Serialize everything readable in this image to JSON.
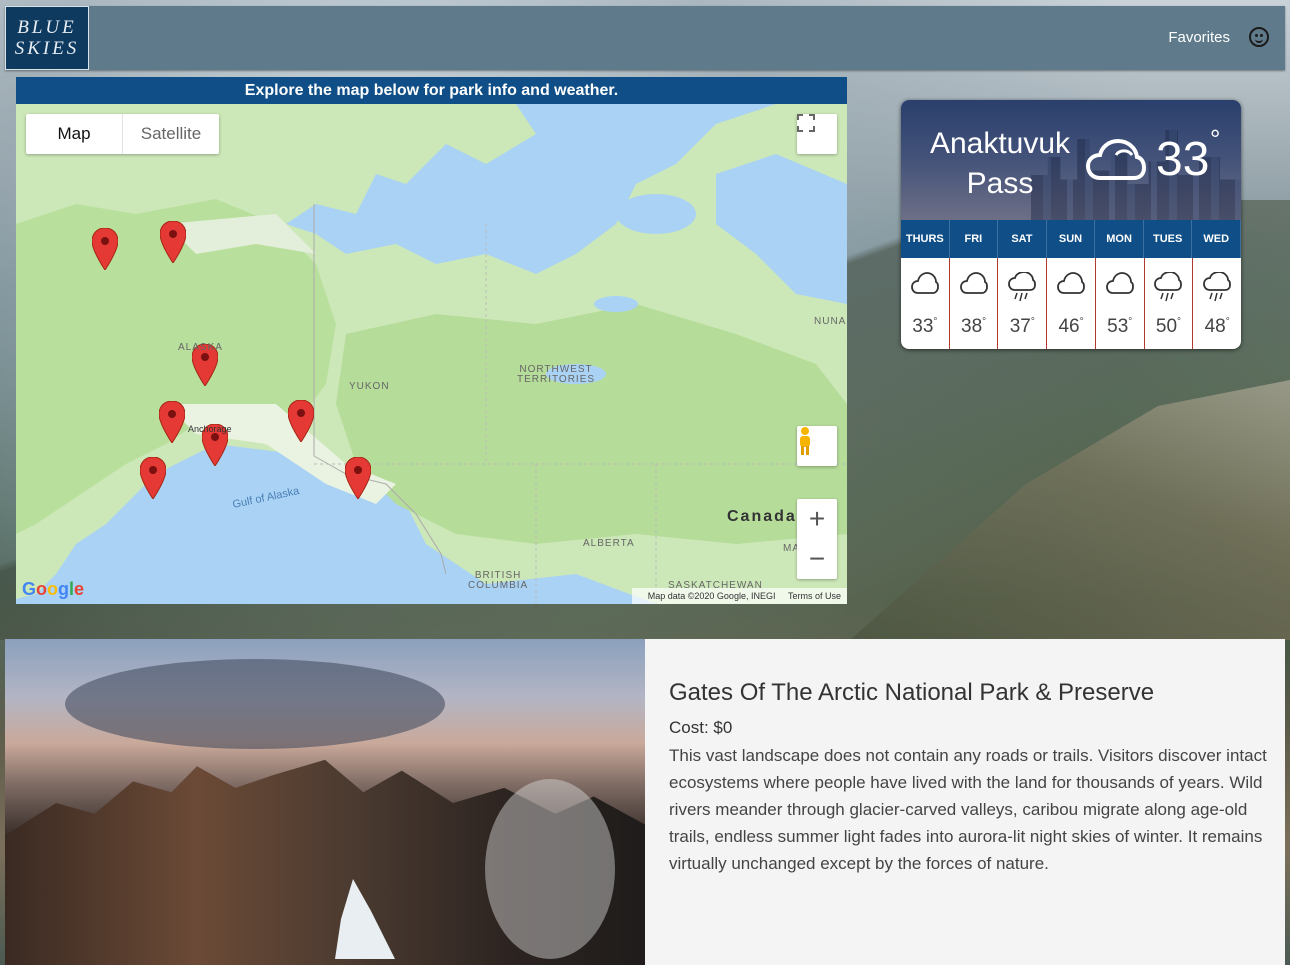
{
  "header": {
    "logo_line1": "BLUE",
    "logo_line2": "SKIES",
    "favorites_label": "Favorites",
    "favorites_icon": "smiley-icon"
  },
  "map_panel": {
    "banner": "Explore the map below for park info and weather.",
    "map_type_options": [
      "Map",
      "Satellite"
    ],
    "selected_map_type": "Map",
    "labels": {
      "yukon": "YUKON",
      "northwest": "NORTHWEST",
      "territories": "TERRITORIES",
      "alaska": "ALASKA",
      "anchorage": "Anchorage",
      "gulf": "Gulf of Alaska",
      "canada": "Canada",
      "alberta": "ALBERTA",
      "bc1": "BRITISH",
      "bc2": "COLUMBIA",
      "saskatchewan": "SASKATCHEWAN",
      "nunavut": "NUNA",
      "manitoba": "MA"
    },
    "attribution": "Map data ©2020 Google, INEGI",
    "terms": "Terms of Use",
    "google_logo": "Google",
    "marker_count": 8
  },
  "weather": {
    "city_line1": "Anaktuvuk",
    "city_line2": "Pass",
    "current_temp": "33",
    "degree_symbol": "°",
    "current_icon": "cloud-icon",
    "forecast": [
      {
        "day": "THURS",
        "temp": "33",
        "icon": "cloud-icon"
      },
      {
        "day": "FRI",
        "temp": "38",
        "icon": "cloud-icon"
      },
      {
        "day": "SAT",
        "temp": "37",
        "icon": "rain-icon"
      },
      {
        "day": "SUN",
        "temp": "46",
        "icon": "cloud-icon"
      },
      {
        "day": "MON",
        "temp": "53",
        "icon": "cloud-icon"
      },
      {
        "day": "TUES",
        "temp": "50",
        "icon": "rain-icon"
      },
      {
        "day": "WED",
        "temp": "48",
        "icon": "rain-icon"
      }
    ]
  },
  "park": {
    "name": "Gates Of The Arctic National Park & Preserve",
    "cost": "Cost: $0",
    "description": "This vast landscape does not contain any roads or trails. Visitors discover intact ecosystems where people have lived with the land for thousands of years. Wild rivers meander through glacier-carved valleys, caribou migrate along age-old trails, endless summer light fades into aurora-lit night skies of winter. It remains virtually unchanged except by the forces of nature."
  },
  "colors": {
    "header_bg": "#5f7a8a",
    "logo_bg": "#0e3a60",
    "banner_bg": "#0f4e86",
    "marker_red": "#e53935"
  }
}
